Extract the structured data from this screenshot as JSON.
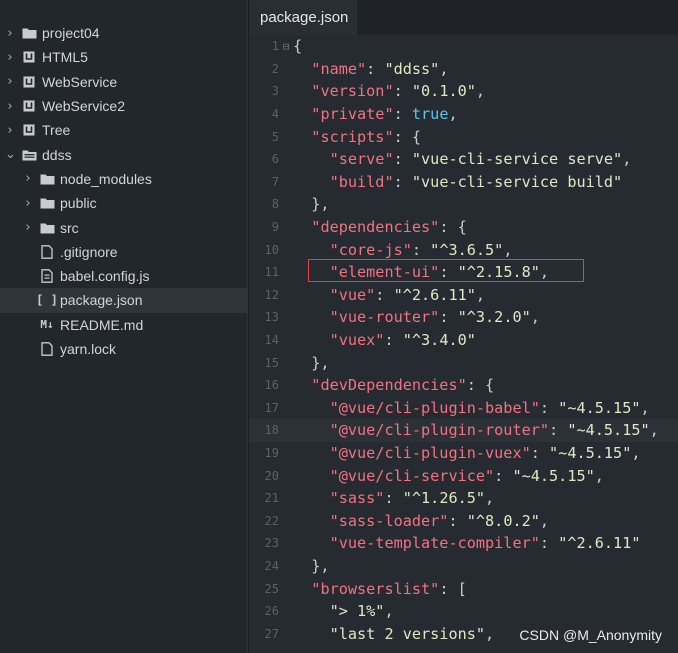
{
  "sidebar": {
    "items": [
      {
        "label": "project04",
        "chevron": "›",
        "icon": "folder-icon",
        "indent": 0
      },
      {
        "label": "HTML5",
        "chevron": "›",
        "icon": "project-icon",
        "indent": 0
      },
      {
        "label": "WebService",
        "chevron": "›",
        "icon": "project-icon",
        "indent": 0
      },
      {
        "label": "WebService2",
        "chevron": "›",
        "icon": "project-icon",
        "indent": 0
      },
      {
        "label": "Tree",
        "chevron": "›",
        "icon": "project-icon",
        "indent": 0
      },
      {
        "label": "ddss",
        "chevron": "⌄",
        "icon": "folder-open-icon",
        "indent": 0
      },
      {
        "label": "node_modules",
        "chevron": "›",
        "icon": "folder-icon",
        "indent": 1
      },
      {
        "label": "public",
        "chevron": "›",
        "icon": "folder-icon",
        "indent": 1
      },
      {
        "label": "src",
        "chevron": "›",
        "icon": "folder-icon",
        "indent": 1
      },
      {
        "label": ".gitignore",
        "chevron": "",
        "icon": "file-icon",
        "indent": 1
      },
      {
        "label": "babel.config.js",
        "chevron": "",
        "icon": "js-file-icon",
        "indent": 1
      },
      {
        "label": "package.json",
        "chevron": "",
        "icon": "json-file-icon",
        "indent": 1,
        "selected": true
      },
      {
        "label": "README.md",
        "chevron": "",
        "icon": "markdown-icon",
        "indent": 1
      },
      {
        "label": "yarn.lock",
        "chevron": "",
        "icon": "file-icon",
        "indent": 1
      }
    ]
  },
  "tab": {
    "label": "package.json"
  },
  "editor": {
    "lines": [
      {
        "n": "1",
        "fold": "⊟",
        "tokens": [
          [
            "p",
            "{"
          ]
        ]
      },
      {
        "n": "2",
        "tokens": [
          [
            "p",
            "  "
          ],
          [
            "k",
            "\"name\""
          ],
          [
            "p",
            ": "
          ],
          [
            "s",
            "\"ddss\""
          ],
          [
            "p",
            ","
          ]
        ]
      },
      {
        "n": "3",
        "tokens": [
          [
            "p",
            "  "
          ],
          [
            "k",
            "\"version\""
          ],
          [
            "p",
            ": "
          ],
          [
            "s",
            "\"0.1.0\""
          ],
          [
            "p",
            ","
          ]
        ]
      },
      {
        "n": "4",
        "tokens": [
          [
            "p",
            "  "
          ],
          [
            "k",
            "\"private\""
          ],
          [
            "p",
            ": "
          ],
          [
            "b",
            "true"
          ],
          [
            "p",
            ","
          ]
        ]
      },
      {
        "n": "5",
        "tokens": [
          [
            "p",
            "  "
          ],
          [
            "k",
            "\"scripts\""
          ],
          [
            "p",
            ": {"
          ]
        ]
      },
      {
        "n": "6",
        "tokens": [
          [
            "p",
            "    "
          ],
          [
            "k",
            "\"serve\""
          ],
          [
            "p",
            ": "
          ],
          [
            "s",
            "\"vue-cli-service serve\""
          ],
          [
            "p",
            ","
          ]
        ]
      },
      {
        "n": "7",
        "tokens": [
          [
            "p",
            "    "
          ],
          [
            "k",
            "\"build\""
          ],
          [
            "p",
            ": "
          ],
          [
            "s",
            "\"vue-cli-service build\""
          ]
        ]
      },
      {
        "n": "8",
        "tokens": [
          [
            "p",
            "  },"
          ]
        ]
      },
      {
        "n": "9",
        "tokens": [
          [
            "p",
            "  "
          ],
          [
            "k",
            "\"dependencies\""
          ],
          [
            "p",
            ": {"
          ]
        ]
      },
      {
        "n": "10",
        "tokens": [
          [
            "p",
            "    "
          ],
          [
            "k",
            "\"core-js\""
          ],
          [
            "p",
            ": "
          ],
          [
            "s",
            "\"^3.6.5\""
          ],
          [
            "p",
            ","
          ]
        ]
      },
      {
        "n": "11",
        "tokens": [
          [
            "p",
            "    "
          ],
          [
            "k",
            "\"element-ui\""
          ],
          [
            "p",
            ": "
          ],
          [
            "s",
            "\"^2.15.8\""
          ],
          [
            "p",
            ","
          ]
        ]
      },
      {
        "n": "12",
        "tokens": [
          [
            "p",
            "    "
          ],
          [
            "k",
            "\"vue\""
          ],
          [
            "p",
            ": "
          ],
          [
            "s",
            "\"^2.6.11\""
          ],
          [
            "p",
            ","
          ]
        ]
      },
      {
        "n": "13",
        "tokens": [
          [
            "p",
            "    "
          ],
          [
            "k",
            "\"vue-router\""
          ],
          [
            "p",
            ": "
          ],
          [
            "s",
            "\"^3.2.0\""
          ],
          [
            "p",
            ","
          ]
        ]
      },
      {
        "n": "14",
        "tokens": [
          [
            "p",
            "    "
          ],
          [
            "k",
            "\"vuex\""
          ],
          [
            "p",
            ": "
          ],
          [
            "s",
            "\"^3.4.0\""
          ]
        ]
      },
      {
        "n": "15",
        "tokens": [
          [
            "p",
            "  },"
          ]
        ]
      },
      {
        "n": "16",
        "tokens": [
          [
            "p",
            "  "
          ],
          [
            "k",
            "\"devDependencies\""
          ],
          [
            "p",
            ": {"
          ]
        ]
      },
      {
        "n": "17",
        "tokens": [
          [
            "p",
            "    "
          ],
          [
            "k",
            "\"@vue/cli-plugin-babel\""
          ],
          [
            "p",
            ": "
          ],
          [
            "s",
            "\"~4.5.15\""
          ],
          [
            "p",
            ","
          ]
        ]
      },
      {
        "n": "18",
        "hl": true,
        "tokens": [
          [
            "p",
            "    "
          ],
          [
            "k",
            "\"@vue/cli-plugin-router\""
          ],
          [
            "p",
            ": "
          ],
          [
            "s",
            "\"~4.5.15\""
          ],
          [
            "p",
            ","
          ]
        ]
      },
      {
        "n": "19",
        "tokens": [
          [
            "p",
            "    "
          ],
          [
            "k",
            "\"@vue/cli-plugin-vuex\""
          ],
          [
            "p",
            ": "
          ],
          [
            "s",
            "\"~4.5.15\""
          ],
          [
            "p",
            ","
          ]
        ]
      },
      {
        "n": "20",
        "tokens": [
          [
            "p",
            "    "
          ],
          [
            "k",
            "\"@vue/cli-service\""
          ],
          [
            "p",
            ": "
          ],
          [
            "s",
            "\"~4.5.15\""
          ],
          [
            "p",
            ","
          ]
        ]
      },
      {
        "n": "21",
        "tokens": [
          [
            "p",
            "    "
          ],
          [
            "k",
            "\"sass\""
          ],
          [
            "p",
            ": "
          ],
          [
            "s",
            "\"^1.26.5\""
          ],
          [
            "p",
            ","
          ]
        ]
      },
      {
        "n": "22",
        "tokens": [
          [
            "p",
            "    "
          ],
          [
            "k",
            "\"sass-loader\""
          ],
          [
            "p",
            ": "
          ],
          [
            "s",
            "\"^8.0.2\""
          ],
          [
            "p",
            ","
          ]
        ]
      },
      {
        "n": "23",
        "tokens": [
          [
            "p",
            "    "
          ],
          [
            "k",
            "\"vue-template-compiler\""
          ],
          [
            "p",
            ": "
          ],
          [
            "s",
            "\"^2.6.11\""
          ]
        ]
      },
      {
        "n": "24",
        "tokens": [
          [
            "p",
            "  },"
          ]
        ]
      },
      {
        "n": "25",
        "tokens": [
          [
            "p",
            "  "
          ],
          [
            "k",
            "\"browserslist\""
          ],
          [
            "p",
            ": ["
          ]
        ]
      },
      {
        "n": "26",
        "tokens": [
          [
            "p",
            "    "
          ],
          [
            "s",
            "\"> 1%\""
          ],
          [
            "p",
            ","
          ]
        ]
      },
      {
        "n": "27",
        "tokens": [
          [
            "p",
            "    "
          ],
          [
            "s",
            "\"last 2 versions\""
          ],
          [
            "p",
            ","
          ]
        ]
      }
    ]
  },
  "watermark": "CSDN @M_Anonymity",
  "colors": {
    "key": "#f4717f",
    "string": "#e3e6c0",
    "boolean": "#5ec4e8",
    "highlight_box": "#e0433a"
  }
}
